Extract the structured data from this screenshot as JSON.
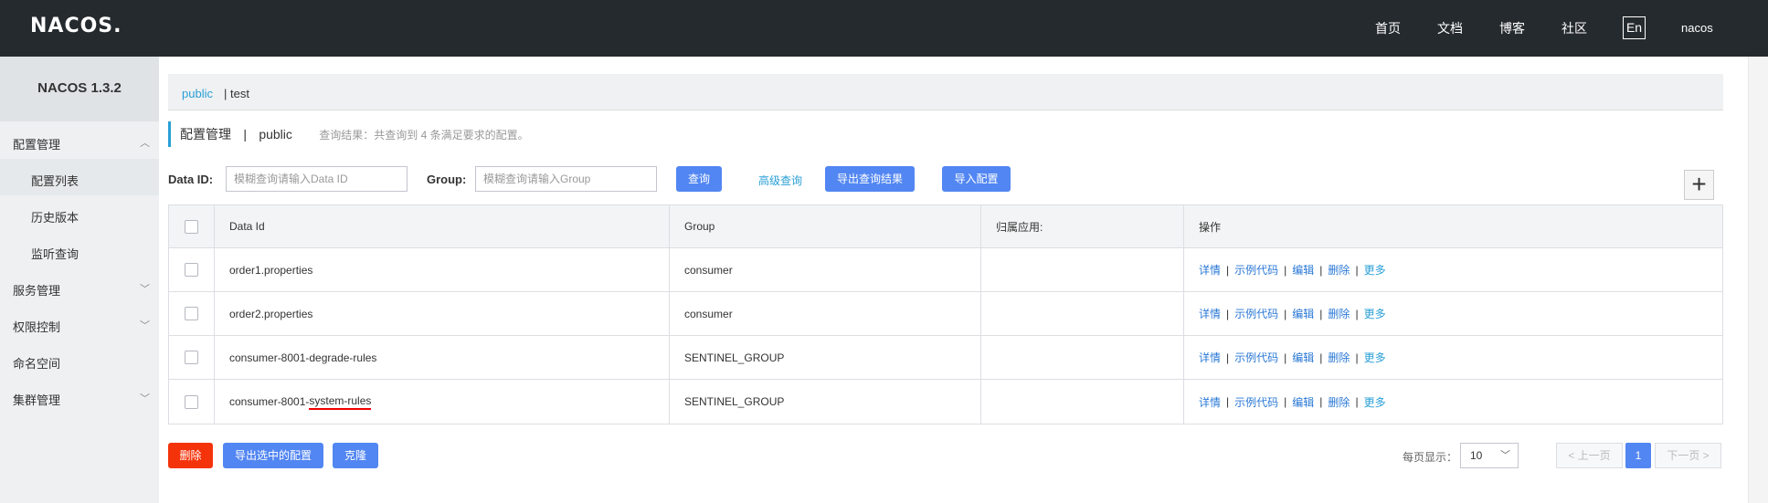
{
  "topbar": {
    "logo": "NACOS.",
    "nav": [
      "首页",
      "文档",
      "博客",
      "社区"
    ],
    "lang": "En",
    "user": "nacos"
  },
  "sidebar": {
    "version": "NACOS 1.3.2",
    "groups": [
      {
        "label": "配置管理",
        "expanded": true,
        "items": [
          "配置列表",
          "历史版本",
          "监听查询"
        ]
      },
      {
        "label": "服务管理",
        "expanded": false
      },
      {
        "label": "权限控制",
        "expanded": false
      },
      {
        "label": "命名空间"
      },
      {
        "label": "集群管理",
        "expanded": false
      }
    ]
  },
  "namespaces": {
    "active": "public",
    "other": "| test"
  },
  "title": {
    "main": "配置管理",
    "sep": "|",
    "ns": "public",
    "result": "查询结果：共查询到 4 条满足要求的配置。"
  },
  "filters": {
    "data_id_label": "Data ID:",
    "data_id_placeholder": "模糊查询请输入Data ID",
    "group_label": "Group:",
    "group_placeholder": "模糊查询请输入Group",
    "query_button": "查询",
    "advanced_link": "高级查询",
    "export_button": "导出查询结果",
    "import_button": "导入配置",
    "add_icon": "+"
  },
  "table": {
    "headers": [
      "Data Id",
      "Group",
      "归属应用:",
      "操作"
    ],
    "rows": [
      {
        "data_id": "order1.properties",
        "group": "consumer",
        "app": ""
      },
      {
        "data_id": "order2.properties",
        "group": "consumer",
        "app": ""
      },
      {
        "data_id": "consumer-8001-degrade-rules",
        "group": "SENTINEL_GROUP",
        "app": ""
      },
      {
        "data_id_prefix": "consumer-8001-",
        "data_id_underlined": "system-rules",
        "group": "SENTINEL_GROUP",
        "app": ""
      }
    ],
    "ops": {
      "detail": "详情",
      "sample": "示例代码",
      "edit": "编辑",
      "delete": "删除",
      "more": "更多",
      "sep": "|"
    }
  },
  "bottom": {
    "delete_button": "删除",
    "export_selected_button": "导出选中的配置",
    "clone_button": "克隆"
  },
  "pager": {
    "per_page_label": "每页显示：",
    "per_page_value": "10",
    "prev": "< 上一页",
    "current": "1",
    "next": "下一页 >"
  },
  "colors": {
    "topbar": "#252a2f",
    "accent": "#2a9fd6",
    "button_blue": "#5286f2",
    "button_red": "#f5330b",
    "annotation_red": "#e00000"
  }
}
